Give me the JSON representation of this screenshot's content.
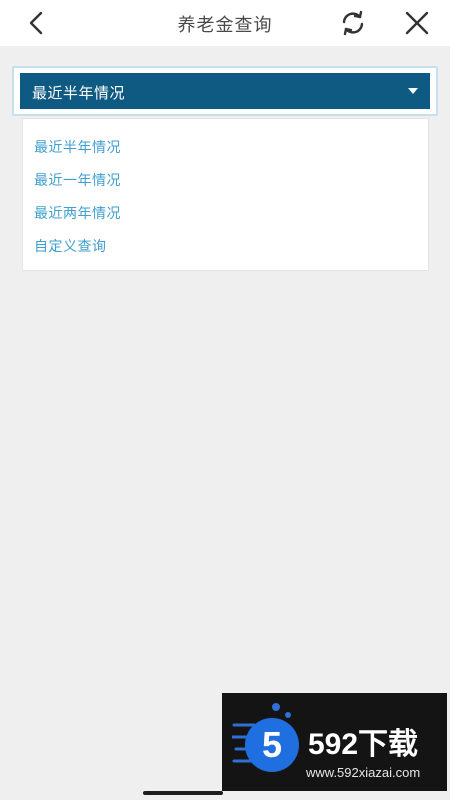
{
  "header": {
    "title": "养老金查询",
    "icons": {
      "back": "chevron-left-icon",
      "refresh": "refresh-icon",
      "close": "close-icon"
    }
  },
  "period_select": {
    "selected": "最近半年情况",
    "options": [
      "最近半年情况",
      "最近一年情况",
      "最近两年情况",
      "自定义查询"
    ]
  },
  "watermark": {
    "brand": "592下载",
    "url": "www.592xiazai.com"
  },
  "colors": {
    "select_bg": "#0f5a82",
    "option_text": "#3f9fd0",
    "page_bg": "#efefef"
  }
}
